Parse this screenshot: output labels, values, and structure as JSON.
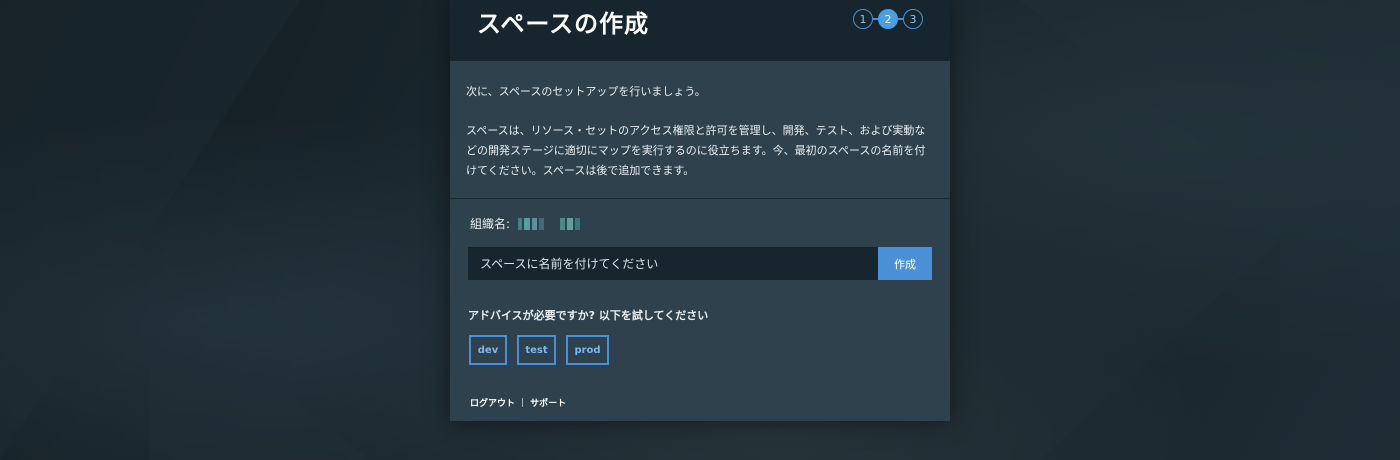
{
  "page": {
    "title": "スペースの作成",
    "steps": [
      {
        "label": "1",
        "active": false
      },
      {
        "label": "2",
        "active": true
      },
      {
        "label": "3",
        "active": false
      }
    ]
  },
  "intro": {
    "line1": "次に、スペースのセットアップを行いましょう。",
    "line2": "スペースは、リソース・セットのアクセス権限と許可を管理し、開発、テスト、および実動などの開発ステージに適切にマップを実行するのに役立ちます。今、最初のスペースの名前を付けてください。スペースは後で追加できます。"
  },
  "org": {
    "label": "組織名:"
  },
  "form": {
    "placeholder": "スペースに名前を付けてください",
    "create_label": "作成"
  },
  "advice": {
    "text": "アドバイスが必要ですか? 以下を試してください",
    "suggestions": [
      "dev",
      "test",
      "prod"
    ]
  },
  "footer": {
    "logout": "ログアウト",
    "separator": "|",
    "support": "サポート"
  },
  "colors": {
    "accent": "#4a90d6",
    "header_bg": "#17262e",
    "card_bg": "#2e414c"
  }
}
